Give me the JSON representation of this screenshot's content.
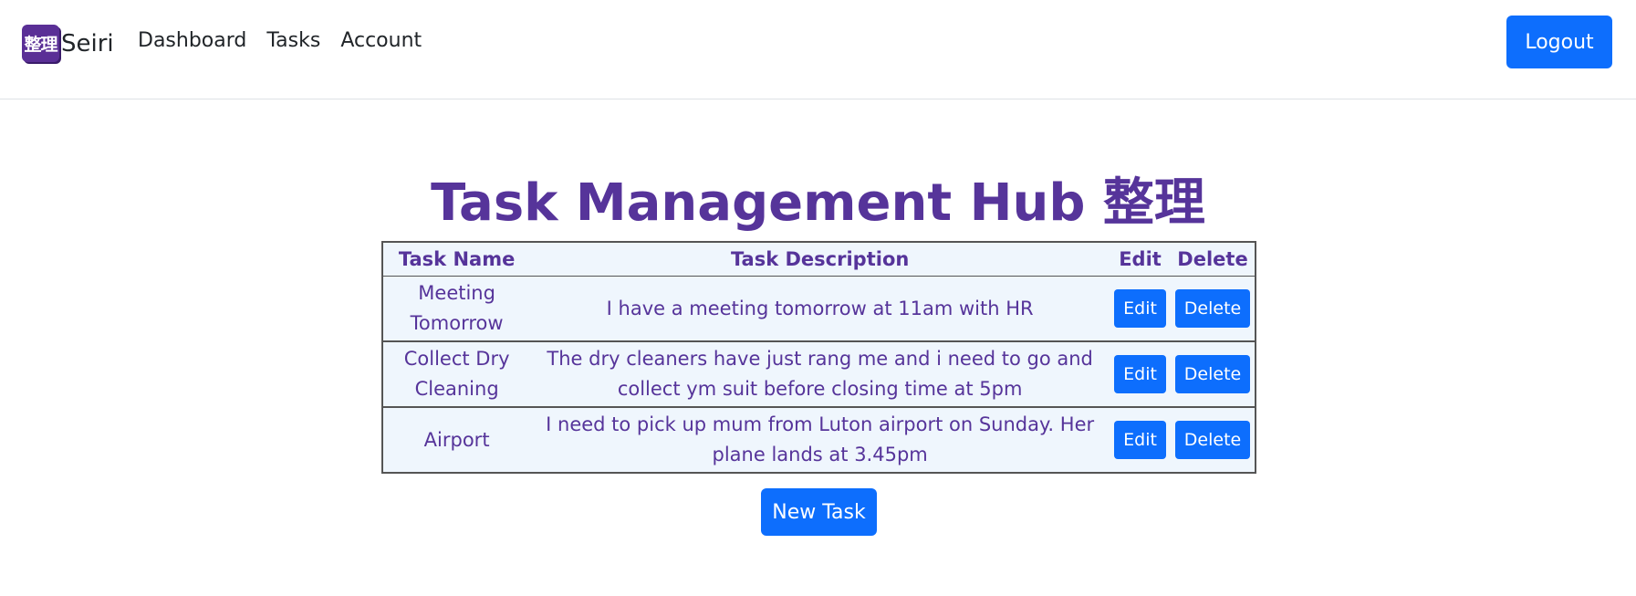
{
  "navbar": {
    "logo_glyph": "整理",
    "brand": "Seiri",
    "links": [
      "Dashboard",
      "Tasks",
      "Account"
    ],
    "logout_label": "Logout"
  },
  "main": {
    "title": "Task Management Hub 整理",
    "table": {
      "headers": [
        "Task Name",
        "Task Description",
        "Edit",
        "Delete"
      ],
      "rows": [
        {
          "name": "Meeting Tomorrow",
          "description": "I have a meeting tomorrow at 11am with HR",
          "edit_label": "Edit",
          "delete_label": "Delete"
        },
        {
          "name": "Collect Dry Cleaning",
          "description": "The dry cleaners have just rang me and i need to go and collect ym suit before closing time at 5pm",
          "edit_label": "Edit",
          "delete_label": "Delete"
        },
        {
          "name": "Airport",
          "description": "I need to pick up mum from Luton airport on Sunday. Her plane lands at 3.45pm",
          "edit_label": "Edit",
          "delete_label": "Delete"
        }
      ]
    },
    "new_task_label": "New Task"
  },
  "colors": {
    "primary": "#0d6efd",
    "title_purple": "#56349a",
    "table_bg": "#eff6fd",
    "logo_bg": "#5a2f96"
  }
}
